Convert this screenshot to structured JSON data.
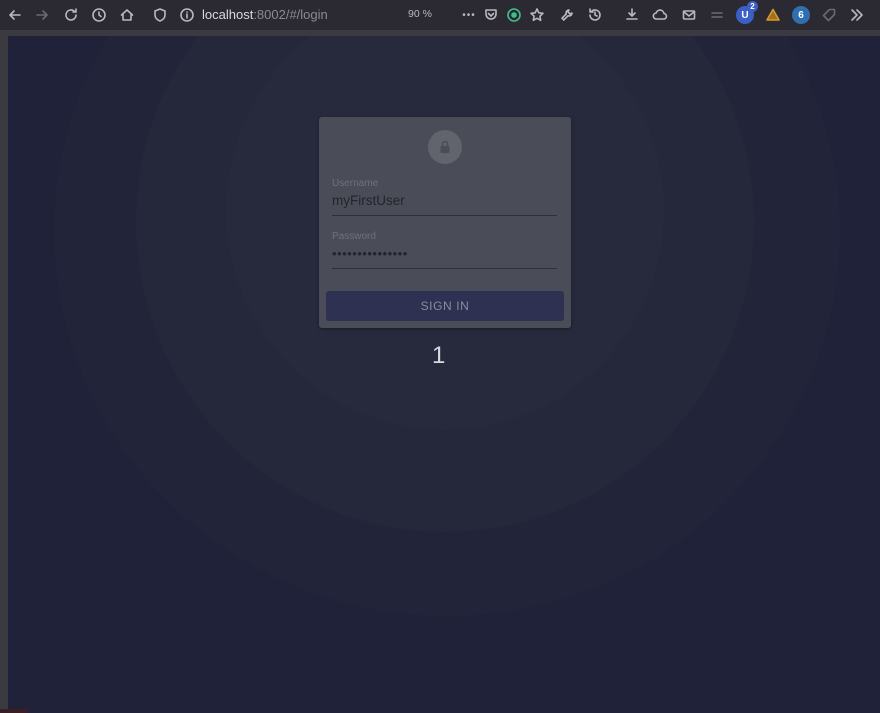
{
  "browser": {
    "url_host": "localhost",
    "url_rest": ":8002/#/login",
    "zoom": "90 %",
    "more_glyph": "•••",
    "ext_badge_count": "2"
  },
  "login": {
    "username_label": "Username",
    "username_value": "myFirstUser",
    "password_label": "Password",
    "password_value": "•••••••••••••••",
    "signin_label": "SIGN IN"
  },
  "overlay": {
    "step_number": "1"
  },
  "colors": {
    "background": "#1f2238",
    "card": "#4a4c57",
    "button": "#2e3152"
  }
}
